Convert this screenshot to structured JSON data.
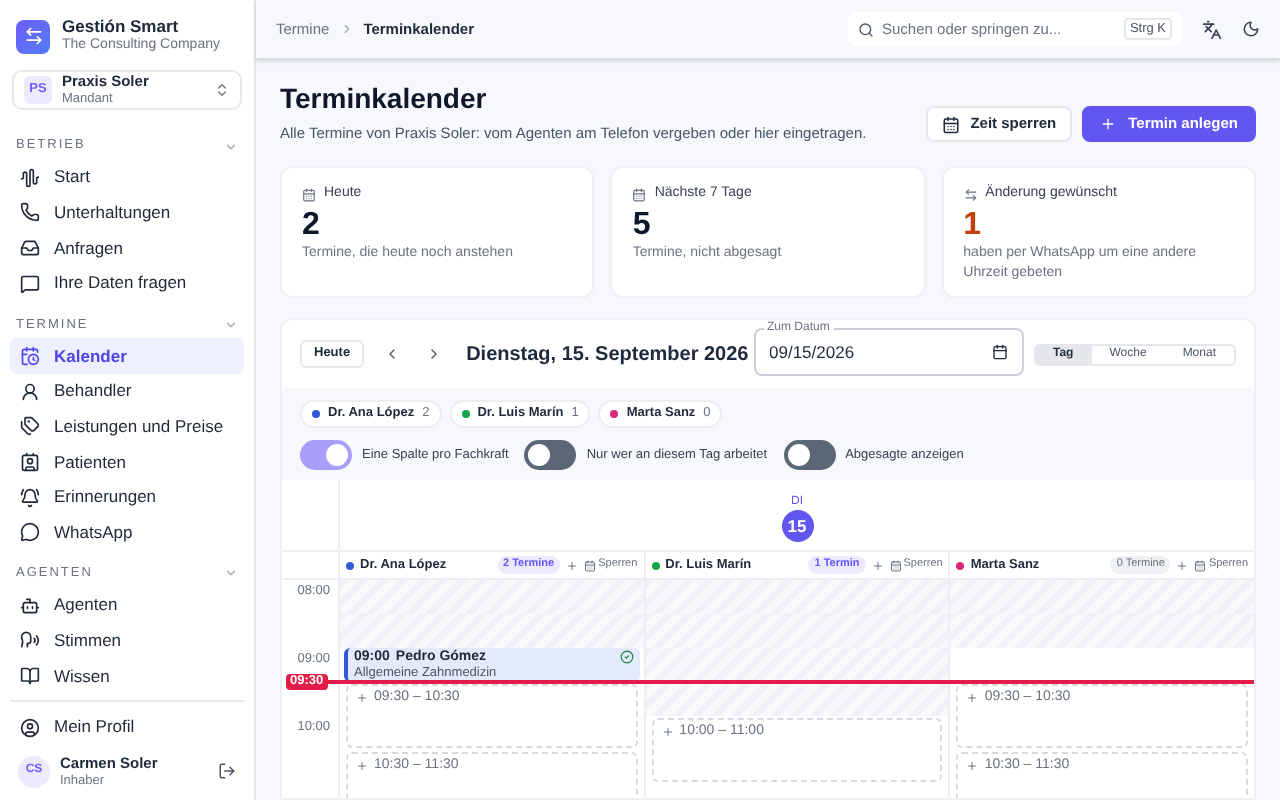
{
  "sidebar": {
    "app": {
      "name": "Gestión Smart",
      "subtitle": "The Consulting Company"
    },
    "tenant": {
      "initials": "PS",
      "name": "Praxis Soler",
      "role": "Mandant"
    },
    "sections": [
      {
        "title": "BETRIEB",
        "expanded": true,
        "items": [
          {
            "label": "Start",
            "selected": false
          },
          {
            "label": "Unterhaltungen",
            "selected": false
          },
          {
            "label": "Anfragen",
            "selected": false
          },
          {
            "label": "Ihre Daten fragen",
            "selected": false
          }
        ]
      },
      {
        "title": "TERMINE",
        "expanded": true,
        "items": [
          {
            "label": "Kalender",
            "selected": true
          },
          {
            "label": "Behandler",
            "selected": false
          },
          {
            "label": "Leistungen und Preise",
            "selected": false
          },
          {
            "label": "Patienten",
            "selected": false
          },
          {
            "label": "Erinnerungen",
            "selected": false
          },
          {
            "label": "WhatsApp",
            "selected": false
          }
        ]
      },
      {
        "title": "AGENTEN",
        "expanded": true,
        "items": [
          {
            "label": "Agenten",
            "selected": false
          },
          {
            "label": "Stimmen",
            "selected": false
          },
          {
            "label": "Wissen",
            "selected": false
          }
        ]
      }
    ],
    "profile_link": "Mein Profil",
    "user": {
      "initials": "CS",
      "name": "Carmen Soler",
      "role": "Inhaber"
    }
  },
  "topbar": {
    "breadcrumb": [
      "Termine",
      "Terminkalender"
    ],
    "search": {
      "placeholder": "Suchen oder springen zu...",
      "shortcut": "Strg K"
    }
  },
  "page": {
    "title": "Terminkalender",
    "subtitle": "Alle Termine von Praxis Soler: vom Agenten am Telefon vergeben oder hier eingetragen.",
    "buttons": [
      {
        "label": "Zeit sperren",
        "kind": "secondary"
      },
      {
        "label": "Termin anlegen",
        "kind": "primary"
      }
    ]
  },
  "stats": [
    {
      "label": "Heute",
      "value": "2",
      "description": "Termine, die heute noch anstehen",
      "highlighted": false
    },
    {
      "label": "Nächste 7 Tage",
      "value": "5",
      "description": "Termine, nicht abgesagt",
      "highlighted": false
    },
    {
      "label": "Änderung gewünscht",
      "value": "1",
      "description": "haben per WhatsApp um eine andere Uhrzeit gebeten",
      "highlighted": true
    }
  ],
  "calendar": {
    "today_button": "Heute",
    "date_title": "Dienstag, 15. September 2026",
    "date_field": {
      "label": "Zum Datum",
      "value": "09/15/2026"
    },
    "views": [
      {
        "label": "Tag",
        "selected": true
      },
      {
        "label": "Woche",
        "selected": false
      },
      {
        "label": "Monat",
        "selected": false
      }
    ],
    "staff_filters": [
      {
        "name": "Dr. Ana López",
        "count": "2",
        "color": "#2f5bd6"
      },
      {
        "name": "Dr. Luis Marín",
        "count": "1",
        "color": "#16a34a"
      },
      {
        "name": "Marta Sanz",
        "count": "0",
        "color": "#db2777"
      }
    ],
    "toggles": [
      {
        "label": "Eine Spalte pro Fachkraft",
        "on": true
      },
      {
        "label": "Nur wer an diesem Tag arbeitet",
        "on": false
      },
      {
        "label": "Abgesagte anzeigen",
        "on": false
      }
    ],
    "day": {
      "weekday": "DI",
      "date": "15"
    },
    "hours": [
      "08:00",
      "09:00",
      "10:00"
    ],
    "now": "09:30",
    "columns": [
      {
        "name": "Dr. Ana López",
        "color": "#2f5bd6",
        "count_label": "2 Termine",
        "has_appointments": true,
        "block_label": "Sperren",
        "items": [
          {
            "kind": "unavailable"
          },
          {
            "kind": "unavailable"
          },
          {
            "kind": "appointment",
            "time": "09:00",
            "patient": "Pedro Gómez",
            "service": "Allgemeine Zahnmedizin",
            "confirmed": true
          },
          {
            "kind": "free_slot",
            "time": "09:30 – 10:30"
          },
          {
            "kind": "free_slot",
            "time": "10:30 – 11:30"
          }
        ]
      },
      {
        "name": "Dr. Luis Marín",
        "color": "#16a34a",
        "count_label": "1 Termin",
        "has_appointments": true,
        "block_label": "Sperren",
        "items": [
          {
            "kind": "unavailable"
          },
          {
            "kind": "unavailable"
          },
          {
            "kind": "unavailable"
          },
          {
            "kind": "unavailable"
          },
          {
            "kind": "free_slot",
            "time": "10:00 – 11:00"
          }
        ]
      },
      {
        "name": "Marta Sanz",
        "color": "#db2777",
        "count_label": "0 Termine",
        "has_appointments": false,
        "block_label": "Sperren",
        "items": [
          {
            "kind": "unavailable"
          },
          {
            "kind": "unavailable"
          },
          {
            "kind": "past"
          },
          {
            "kind": "free_slot",
            "time": "09:30 – 10:30"
          },
          {
            "kind": "free_slot",
            "time": "10:30 – 11:30"
          }
        ]
      }
    ]
  }
}
